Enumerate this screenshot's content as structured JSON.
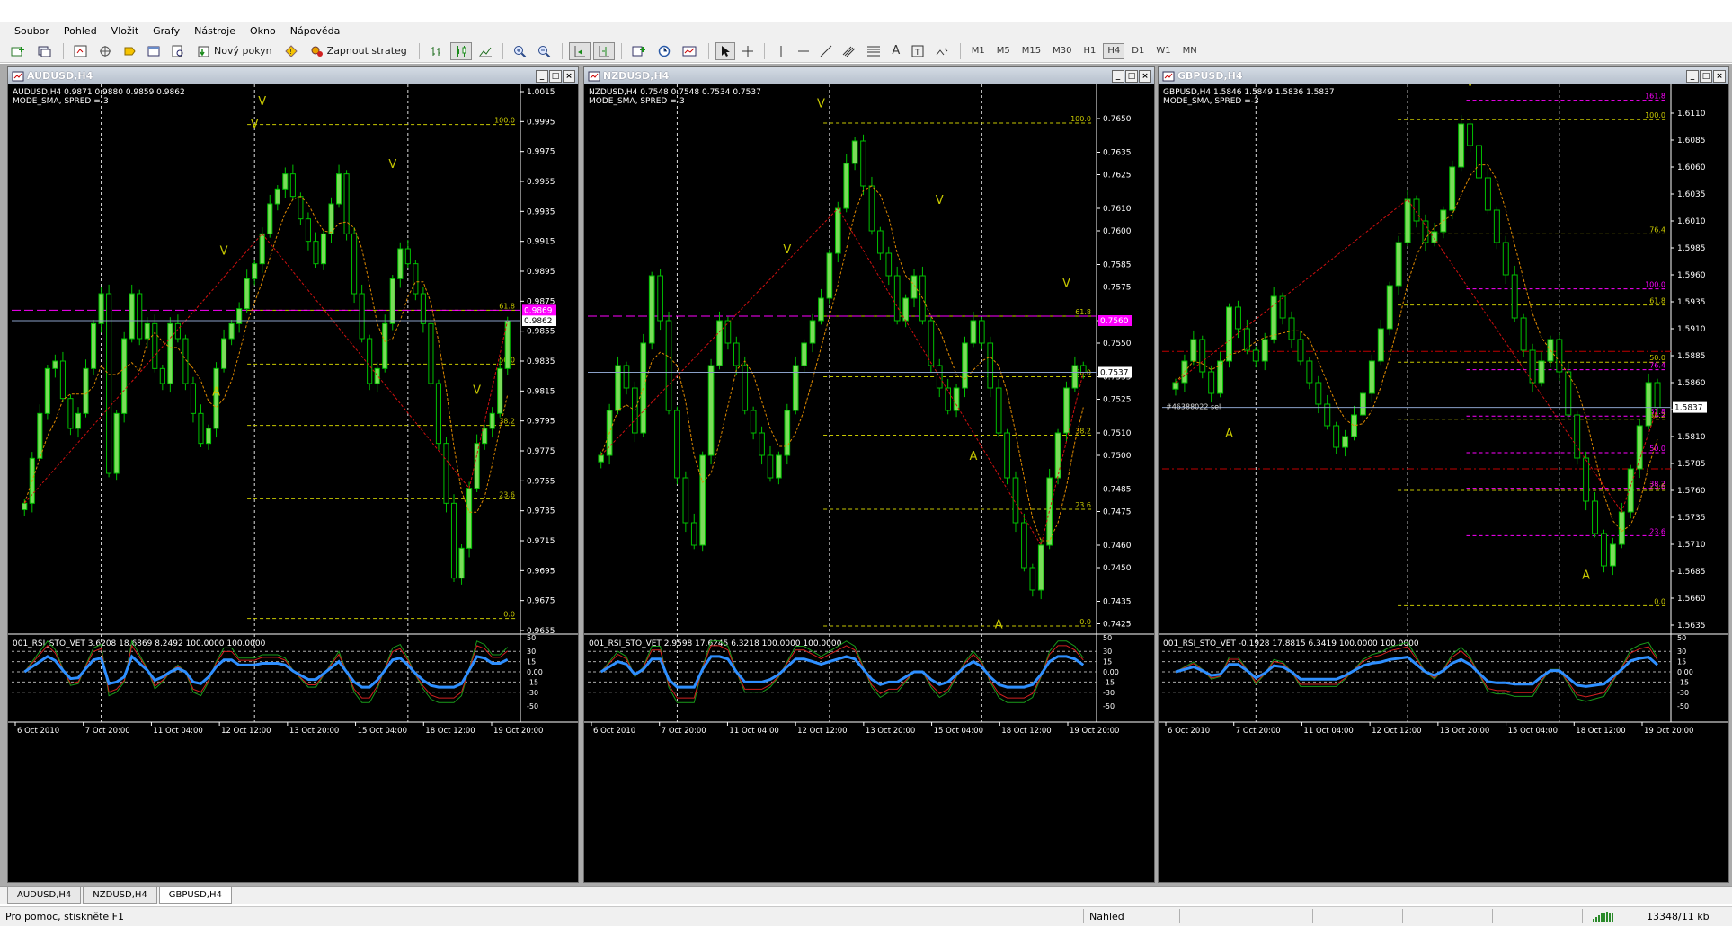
{
  "menu": [
    "Soubor",
    "Pohled",
    "Vložit",
    "Grafy",
    "Nástroje",
    "Okno",
    "Nápověda"
  ],
  "toolbar": {
    "new_order": "Nový pokyn",
    "autotrading": "Zapnout strateg",
    "line_tool_label": "A",
    "timeframes": [
      "M1",
      "M5",
      "M15",
      "M30",
      "H1",
      "H4",
      "D1",
      "W1",
      "MN"
    ],
    "active_timeframe": "H4"
  },
  "colors": {
    "bull": "#7bdc5a",
    "bear": "#00c000",
    "fib": "#c8c800",
    "magenta": "#ff00ff",
    "red": "#c00000",
    "blue": "#2e8fff"
  },
  "charts": [
    {
      "window_title": "AUDUSD,H4",
      "header_line1": "AUDUSD,H4  0.9871 0.9880 0.9859 0.9862",
      "header_line2": "MODE_SMA, SPRED =-3",
      "indicator_label": "001_RSI_STO_VET 3.6208 18.6869 8.2492 100.0000 100.0000",
      "price_current": "0.9862",
      "price_marker": "0.9869",
      "chart_data": {
        "type": "candlestick",
        "ylim": [
          0.9655,
          1.0015
        ],
        "y_ticks": [
          "1.0015",
          "0.9995",
          "0.9975",
          "0.9955",
          "0.9935",
          "0.9915",
          "0.9895",
          "0.9875",
          "0.9855",
          "0.9835",
          "0.9815",
          "0.9795",
          "0.9775",
          "0.9755",
          "0.9735",
          "0.9715",
          "0.9695",
          "0.9675",
          "0.9655"
        ],
        "x_ticks": [
          "6 Oct 2010",
          "7 Oct 20:00",
          "11 Oct 04:00",
          "12 Oct 12:00",
          "13 Oct 20:00",
          "15 Oct 04:00",
          "18 Oct 12:00",
          "19 Oct 20:00"
        ],
        "close": [
          0.974,
          0.977,
          0.98,
          0.983,
          0.9835,
          0.981,
          0.979,
          0.98,
          0.983,
          0.986,
          0.988,
          0.976,
          0.98,
          0.985,
          0.988,
          0.985,
          0.986,
          0.983,
          0.982,
          0.986,
          0.985,
          0.982,
          0.98,
          0.978,
          0.979,
          0.983,
          0.985,
          0.986,
          0.987,
          0.989,
          0.99,
          0.992,
          0.994,
          0.995,
          0.996,
          0.9945,
          0.993,
          0.9915,
          0.99,
          0.992,
          0.994,
          0.996,
          0.992,
          0.988,
          0.985,
          0.982,
          0.983,
          0.986,
          0.989,
          0.991,
          0.99,
          0.988,
          0.986,
          0.982,
          0.978,
          0.974,
          0.969,
          0.971,
          0.975,
          0.978,
          0.979,
          0.98,
          0.983,
          0.9862
        ],
        "fib_levels": [
          {
            "label": "100.0",
            "price": 0.9993
          },
          {
            "label": "61.8",
            "price": 0.9869
          },
          {
            "label": "50.0",
            "price": 0.9833
          },
          {
            "label": "38.2",
            "price": 0.9792
          },
          {
            "label": "23.6",
            "price": 0.9743
          },
          {
            "label": "0.0",
            "price": 0.9663
          }
        ],
        "arrows": [
          {
            "glyph": "V",
            "index": 31,
            "price": 1.0006
          },
          {
            "glyph": "V",
            "index": 30,
            "price": 0.9991
          },
          {
            "glyph": "V",
            "index": 26,
            "price": 0.9906
          },
          {
            "glyph": "A",
            "index": 25,
            "price": 0.9812
          },
          {
            "glyph": "V",
            "index": 48,
            "price": 0.9964
          },
          {
            "glyph": "V",
            "index": 59,
            "price": 0.9813
          }
        ],
        "magenta_line": 0.9869,
        "indicator_ticks": [
          "50",
          "30",
          "15",
          "0.00",
          "-15",
          "-30",
          "-50"
        ]
      }
    },
    {
      "window_title": "NZDUSD,H4",
      "header_line1": "NZDUSD,H4  0.7548 0.7548 0.7534 0.7537",
      "header_line2": "MODE_SMA, SPRED =-3",
      "indicator_label": "001_RSI_STO_VET 2.9598 17.6245 6.3218 100.0000 100.0000",
      "price_current": "0.7537",
      "price_marker": "0.7560",
      "chart_data": {
        "type": "candlestick",
        "ylim": [
          0.7422,
          0.7662
        ],
        "y_ticks": [
          "0.7650",
          "0.7635",
          "0.7625",
          "0.7610",
          "0.7600",
          "0.7585",
          "0.7575",
          "0.7560",
          "0.7550",
          "0.7535",
          "0.7525",
          "0.7510",
          "0.7500",
          "0.7485",
          "0.7475",
          "0.7460",
          "0.7450",
          "0.7435",
          "0.7425"
        ],
        "x_ticks": [
          "6 Oct 2010",
          "7 Oct 20:00",
          "11 Oct 04:00",
          "12 Oct 12:00",
          "13 Oct 20:00",
          "15 Oct 04:00",
          "18 Oct 12:00",
          "19 Oct 20:00"
        ],
        "close": [
          0.75,
          0.752,
          0.754,
          0.753,
          0.751,
          0.755,
          0.758,
          0.756,
          0.752,
          0.749,
          0.747,
          0.746,
          0.75,
          0.754,
          0.756,
          0.755,
          0.754,
          0.752,
          0.751,
          0.75,
          0.749,
          0.75,
          0.752,
          0.754,
          0.755,
          0.756,
          0.757,
          0.759,
          0.761,
          0.763,
          0.764,
          0.762,
          0.76,
          0.759,
          0.758,
          0.756,
          0.757,
          0.758,
          0.756,
          0.754,
          0.753,
          0.752,
          0.753,
          0.755,
          0.756,
          0.755,
          0.753,
          0.751,
          0.749,
          0.747,
          0.745,
          0.744,
          0.746,
          0.749,
          0.751,
          0.753,
          0.754,
          0.7537
        ],
        "fib_levels": [
          {
            "label": "100.0",
            "price": 0.7648
          },
          {
            "label": "61.8",
            "price": 0.7562
          },
          {
            "label": "50.0",
            "price": 0.7535
          },
          {
            "label": "38.2",
            "price": 0.7509
          },
          {
            "label": "23.6",
            "price": 0.7476
          },
          {
            "label": "0.0",
            "price": 0.7424
          }
        ],
        "arrows": [
          {
            "glyph": "V",
            "index": 26,
            "price": 0.7655
          },
          {
            "glyph": "V",
            "index": 22,
            "price": 0.759
          },
          {
            "glyph": "V",
            "index": 40,
            "price": 0.7612
          },
          {
            "glyph": "A",
            "index": 44,
            "price": 0.7498
          },
          {
            "glyph": "V",
            "index": 55,
            "price": 0.7575
          },
          {
            "glyph": "A",
            "index": 47,
            "price": 0.7423
          }
        ],
        "magenta_line": 0.7562,
        "indicator_ticks": [
          "50",
          "30",
          "15",
          "0.00",
          "-15",
          "-30",
          "-50"
        ]
      }
    },
    {
      "window_title": "GBPUSD,H4",
      "header_line1": "GBPUSD,H4  1.5846 1.5849 1.5836 1.5837",
      "header_line2": "MODE_SMA, SPRED =-3",
      "indicator_label": "001_RSI_STO_VET -0.1928 17.8815 6.3419 100.0000 100.0000",
      "price_current": "1.5837",
      "order_label": "#46388022 sel",
      "chart_data": {
        "type": "candlestick",
        "ylim": [
          1.563,
          1.613
        ],
        "y_ticks": [
          "1.6110",
          "1.6085",
          "1.6060",
          "1.6035",
          "1.6010",
          "1.5985",
          "1.5960",
          "1.5935",
          "1.5910",
          "1.5885",
          "1.5860",
          "1.5835",
          "1.5810",
          "1.5785",
          "1.5760",
          "1.5735",
          "1.5710",
          "1.5685",
          "1.5660",
          "1.5635"
        ],
        "x_ticks": [
          "6 Oct 2010",
          "7 Oct 20:00",
          "11 Oct 04:00",
          "12 Oct 12:00",
          "13 Oct 20:00",
          "15 Oct 04:00",
          "18 Oct 12:00",
          "19 Oct 20:00"
        ],
        "close": [
          1.586,
          1.588,
          1.59,
          1.587,
          1.585,
          1.588,
          1.593,
          1.591,
          1.589,
          1.588,
          1.59,
          1.594,
          1.592,
          1.59,
          1.588,
          1.586,
          1.584,
          1.582,
          1.58,
          1.581,
          1.583,
          1.585,
          1.588,
          1.591,
          1.595,
          1.599,
          1.603,
          1.601,
          1.599,
          1.6,
          1.602,
          1.606,
          1.61,
          1.608,
          1.605,
          1.602,
          1.599,
          1.596,
          1.592,
          1.589,
          1.586,
          1.588,
          1.59,
          1.587,
          1.583,
          1.579,
          1.575,
          1.572,
          1.569,
          1.571,
          1.574,
          1.578,
          1.582,
          1.586,
          1.5837
        ],
        "fib_levels": [
          {
            "label": "100.0",
            "price": 1.6104
          },
          {
            "label": "76.4",
            "price": 1.5998
          },
          {
            "label": "61.8",
            "price": 1.5932
          },
          {
            "label": "50.0",
            "price": 1.5879
          },
          {
            "label": "38.2",
            "price": 1.5826
          },
          {
            "label": "23.6",
            "price": 1.576
          },
          {
            "label": "0.0",
            "price": 1.5653
          }
        ],
        "magenta_levels": [
          {
            "label": "161.8",
            "price": 1.6122
          },
          {
            "label": "100.0",
            "price": 1.5947
          },
          {
            "label": "76.4",
            "price": 1.5872
          },
          {
            "label": "61.8",
            "price": 1.5829
          },
          {
            "label": "50.0",
            "price": 1.5795
          },
          {
            "label": "38.2",
            "price": 1.5762
          },
          {
            "label": "23.6",
            "price": 1.5718
          }
        ],
        "red_levels": [
          1.5889,
          1.578
        ],
        "arrows": [
          {
            "glyph": "V",
            "index": 33,
            "price": 1.6135
          },
          {
            "glyph": "A",
            "index": 6,
            "price": 1.5809
          },
          {
            "glyph": "A",
            "index": 46,
            "price": 1.5678
          }
        ],
        "indicator_ticks": [
          "50",
          "30",
          "15",
          "0.00",
          "-15",
          "-30",
          "-50"
        ]
      }
    }
  ],
  "tabs": [
    "AUDUSD,H4",
    "NZDUSD,H4",
    "GBPUSD,H4"
  ],
  "active_tab": "GBPUSD,H4",
  "status": {
    "help": "Pro pomoc, stiskněte F1",
    "mode": "Nahled",
    "traffic": "13348/11 kb"
  }
}
